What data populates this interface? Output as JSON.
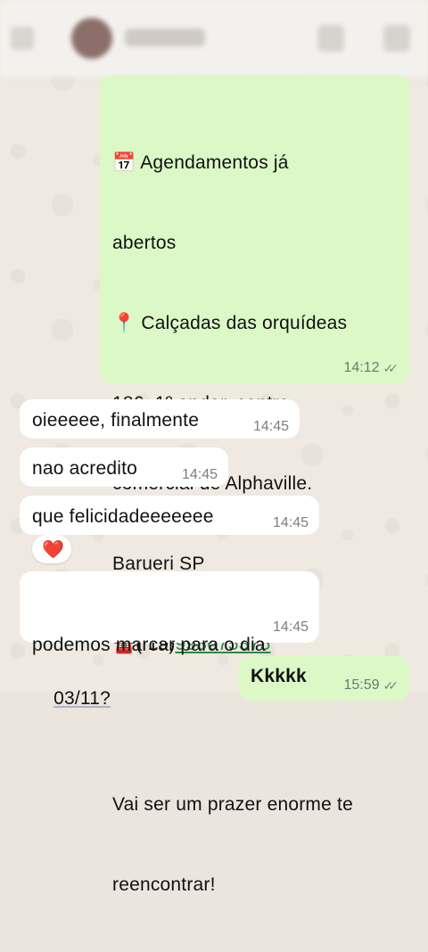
{
  "header": {
    "contact_name": "",
    "blurred": true
  },
  "messages": [
    {
      "direction": "outgoing",
      "lines": [
        "📅 Agendamentos já",
        "abertos",
        "📍 Calçadas das orquídeas",
        "186, 1º andar, centro",
        "comercial de Alphaville.",
        "Barueri SP"
      ],
      "phone_prefix": "☎️( 19)",
      "phone_number": "993675375",
      "closing_lines": [
        "Vai ser um prazer enorme te",
        "reencontrar!"
      ],
      "time": "14:12",
      "status": "read"
    },
    {
      "direction": "incoming",
      "text": "oieeeee, finalmente",
      "time": "14:45"
    },
    {
      "direction": "incoming",
      "text": "nao acredito",
      "time": "14:45"
    },
    {
      "direction": "incoming",
      "text": "que felicidadeeeeeee",
      "time": "14:45",
      "reaction": "❤️"
    },
    {
      "direction": "incoming",
      "text_line1": "podemos marcar para o dia",
      "text_line2": "03/11?",
      "time": "14:45"
    },
    {
      "direction": "outgoing",
      "text": "Kkkkk",
      "time": "15:59",
      "status": "read"
    }
  ],
  "colors": {
    "outgoing_bubble": "#dcf8c6",
    "incoming_bubble": "#ffffff",
    "link": "#2b8a3e",
    "wallpaper": "#efe9e1"
  }
}
